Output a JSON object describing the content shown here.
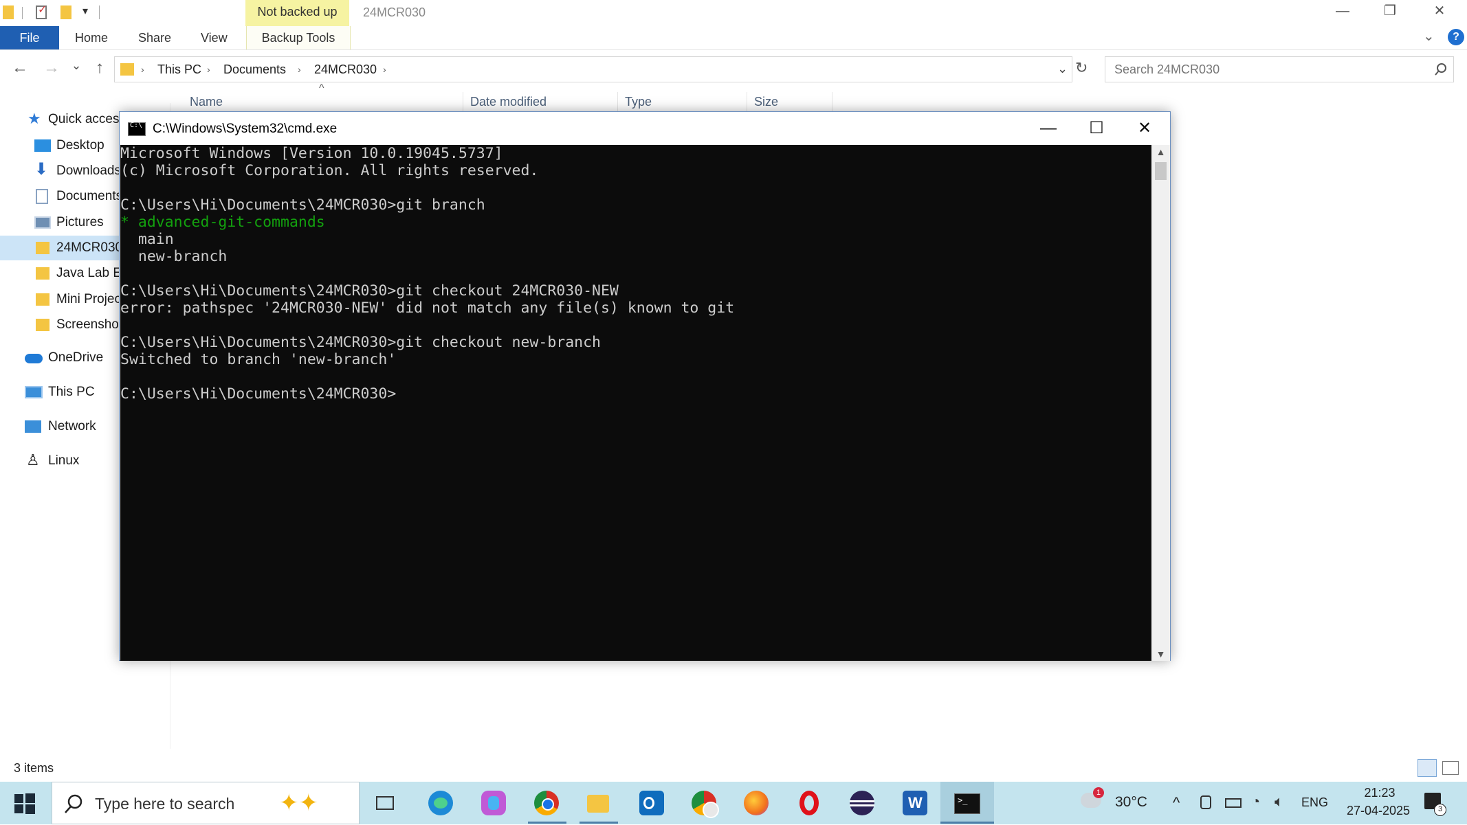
{
  "titlebar": {
    "context_tab": "Not backed up",
    "window_title": "24MCR030",
    "minimize_glyph": "—",
    "restore_glyph": "❐",
    "close_glyph": "✕"
  },
  "ribbon": {
    "tabs": [
      "File",
      "Home",
      "Share",
      "View",
      "Backup Tools"
    ],
    "expand_glyph": "⌄",
    "help_glyph": "?"
  },
  "address": {
    "back": "←",
    "forward": "→",
    "recent": "⌄",
    "up": "↑",
    "breadcrumbs": [
      "This PC",
      "Documents",
      "24MCR030"
    ],
    "separator": "›",
    "dropdown": "⌄",
    "refresh": "↻",
    "search_placeholder": "Search 24MCR030"
  },
  "columns": {
    "name": "Name",
    "date_modified": "Date modified",
    "type": "Type",
    "size": "Size",
    "sort_glyph": "^"
  },
  "navpane": {
    "items": [
      {
        "label": "Quick access",
        "icon": "star-icon",
        "color": "#2f7bd6"
      },
      {
        "label": "Desktop",
        "icon": "desktop-icon",
        "color": "#2b8fe0"
      },
      {
        "label": "Downloads",
        "icon": "download-icon",
        "color": "#2b6cc4"
      },
      {
        "label": "Documents",
        "icon": "document-icon",
        "color": "#8aa3c2"
      },
      {
        "label": "Pictures",
        "icon": "pictures-icon",
        "color": "#6f8fb3"
      },
      {
        "label": "24MCR030",
        "icon": "folder-icon",
        "color": "#f4c542"
      },
      {
        "label": "Java Lab Ex",
        "icon": "folder-icon",
        "color": "#f4c542"
      },
      {
        "label": "Mini Projec",
        "icon": "folder-icon",
        "color": "#f4c542"
      },
      {
        "label": "Screenshot",
        "icon": "folder-icon",
        "color": "#f4c542"
      },
      {
        "label": "OneDrive",
        "icon": "cloud-icon",
        "color": "#1f7ad6"
      },
      {
        "label": "This PC",
        "icon": "computer-icon",
        "color": "#3b8fd9"
      },
      {
        "label": "Network",
        "icon": "network-icon",
        "color": "#3b8fd9"
      },
      {
        "label": "Linux",
        "icon": "penguin-icon",
        "color": "#222222"
      }
    ]
  },
  "status": {
    "items_count": "3 items"
  },
  "cmd": {
    "title": "C:\\Windows\\System32\\cmd.exe",
    "minimize_glyph": "—",
    "maximize_glyph": "☐",
    "close_glyph": "✕",
    "lines": [
      "Microsoft Windows [Version 10.0.19045.5737]",
      "(c) Microsoft Corporation. All rights reserved.",
      "",
      "C:\\Users\\Hi\\Documents\\24MCR030>git branch",
      "* advanced-git-commands",
      "  main",
      "  new-branch",
      "",
      "C:\\Users\\Hi\\Documents\\24MCR030>git checkout 24MCR030-NEW",
      "error: pathspec '24MCR030-NEW' did not match any file(s) known to git",
      "",
      "C:\\Users\\Hi\\Documents\\24MCR030>git checkout new-branch",
      "Switched to branch 'new-branch'",
      "",
      "C:\\Users\\Hi\\Documents\\24MCR030>"
    ],
    "scroll_up": "▲",
    "scroll_down": "▼"
  },
  "taskbar": {
    "search_text": "Type here to search",
    "apps": [
      {
        "name": "task-view-icon",
        "color": "#333333"
      },
      {
        "name": "edge-icon",
        "color": "#1d8ad6"
      },
      {
        "name": "copilot-icon",
        "color": "#c05ad6"
      },
      {
        "name": "chrome-icon",
        "color": "#2ea44f"
      },
      {
        "name": "file-explorer-icon",
        "color": "#f4c542"
      },
      {
        "name": "outlook-icon",
        "color": "#0f6cbd"
      },
      {
        "name": "chrome-profile-icon",
        "color": "#d64141"
      },
      {
        "name": "firefox-icon",
        "color": "#f2711c"
      },
      {
        "name": "opera-icon",
        "color": "#e0121a"
      },
      {
        "name": "eclipse-icon",
        "color": "#2c2255"
      },
      {
        "name": "word-icon",
        "color": "#1f5fb2"
      },
      {
        "name": "terminal-icon",
        "color": "#111111"
      }
    ],
    "weather_badge": "1",
    "temperature": "30°C",
    "tray_chevron": "^",
    "language": "ENG",
    "time": "21:23",
    "date": "27-04-2025",
    "notification_count": "3"
  }
}
